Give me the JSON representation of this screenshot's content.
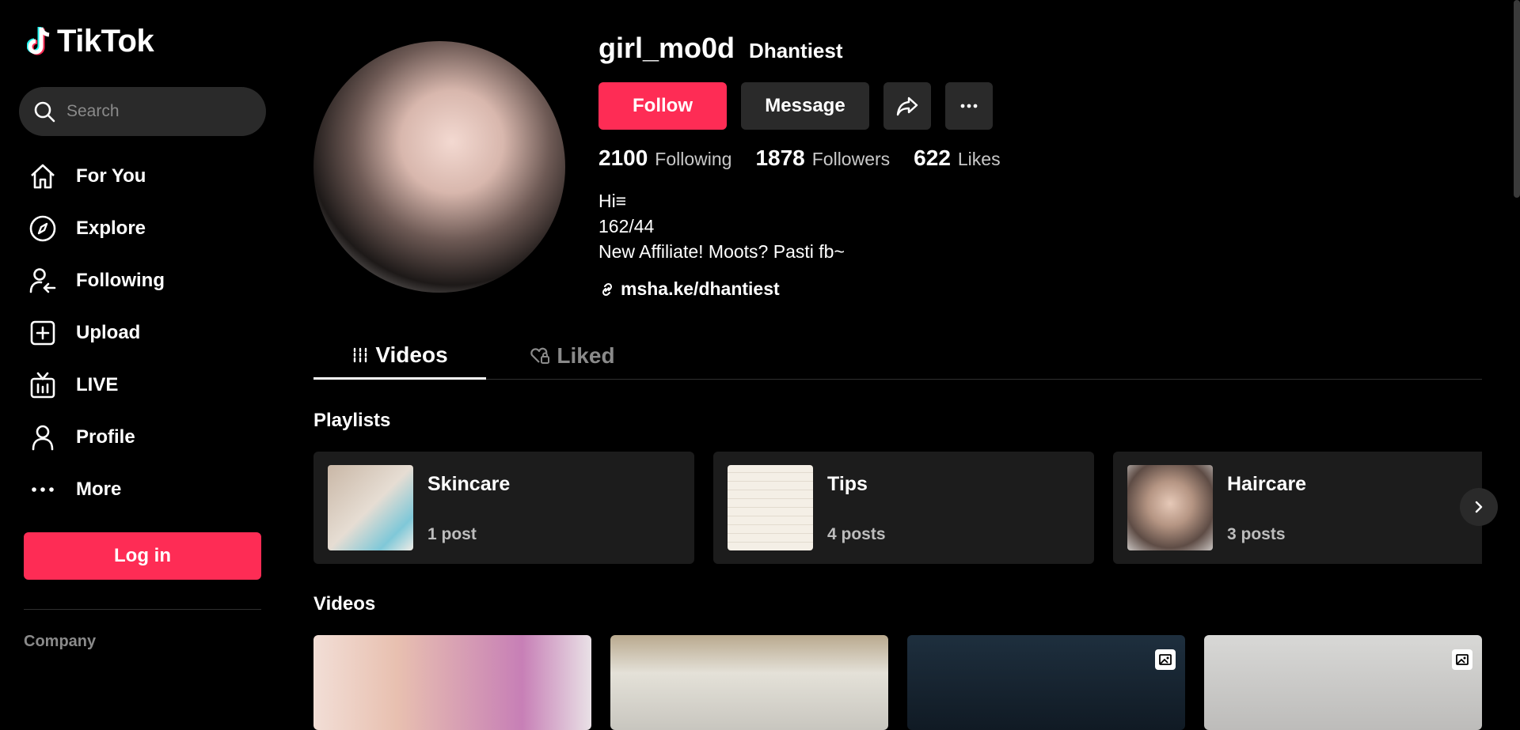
{
  "app": {
    "logo_text": "TikTok",
    "accent_color": "#fe2c55"
  },
  "sidebar": {
    "search_placeholder": "Search",
    "items": [
      {
        "label": "For You",
        "icon": "home-icon"
      },
      {
        "label": "Explore",
        "icon": "compass-icon"
      },
      {
        "label": "Following",
        "icon": "following-icon"
      },
      {
        "label": "Upload",
        "icon": "upload-icon"
      },
      {
        "label": "LIVE",
        "icon": "live-icon"
      },
      {
        "label": "Profile",
        "icon": "profile-icon"
      },
      {
        "label": "More",
        "icon": "more-icon"
      }
    ],
    "login_label": "Log in",
    "company_label": "Company"
  },
  "profile": {
    "username": "girl_mo0d",
    "nickname": "Dhantiest",
    "follow_label": "Follow",
    "message_label": "Message",
    "stats": [
      {
        "value": "2100",
        "label": "Following"
      },
      {
        "value": "1878",
        "label": "Followers"
      },
      {
        "value": "622",
        "label": "Likes"
      }
    ],
    "bio": [
      "Hi≡",
      "162/44",
      "New Affiliate! Moots? Pasti fb~"
    ],
    "link": "msha.ke/dhantiest"
  },
  "tabs": [
    {
      "label": "Videos",
      "icon": "grid-icon",
      "active": true
    },
    {
      "label": "Liked",
      "icon": "heart-lock-icon",
      "active": false
    }
  ],
  "playlists": {
    "title": "Playlists",
    "items": [
      {
        "name": "Skincare",
        "count": "1 post"
      },
      {
        "name": "Tips",
        "count": "4 posts"
      },
      {
        "name": "Haircare",
        "count": "3 posts"
      }
    ]
  },
  "videos": {
    "title": "Videos"
  }
}
